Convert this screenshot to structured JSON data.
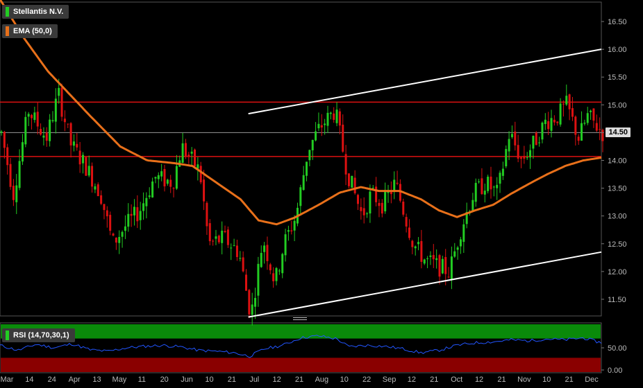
{
  "chart_data": {
    "type": "candlestick",
    "symbol": "Stellantis N.V.",
    "indicator_label": "EMA (50,0)",
    "rsi_label": "RSI (14,70,30,1)",
    "last_price_label": "14.50",
    "last_price": 14.5,
    "price_ylim": [
      11.2,
      16.85
    ],
    "price_ticks": [
      "11.50",
      "12.00",
      "12.50",
      "13.00",
      "13.50",
      "14.00",
      "14.50",
      "15.00",
      "15.50",
      "16.00",
      "16.50"
    ],
    "rsi_ticks": [
      "0.00",
      "50.00"
    ],
    "rsi_ylim": [
      0,
      100
    ],
    "rsi_overbought": 70,
    "rsi_oversold": 30,
    "x_labels": [
      "Mar",
      "14",
      "24",
      "Apr",
      "13",
      "May",
      "11",
      "20",
      "Jun",
      "10",
      "21",
      "Jul",
      "12",
      "21",
      "Aug",
      "10",
      "22",
      "Sep",
      "12",
      "21",
      "Oct",
      "12",
      "21",
      "Nov",
      "10",
      "21",
      "Dec"
    ],
    "horizontal_levels": [
      15.05,
      14.07
    ],
    "trend_channel": {
      "upper": [
        [
          0.413,
          14.84
        ],
        [
          1.0,
          16.0
        ]
      ],
      "lower": [
        [
          0.413,
          11.18
        ],
        [
          1.0,
          12.35
        ]
      ]
    },
    "anchors": [
      [
        0,
        14.5
      ],
      [
        0.02,
        13.4
      ],
      [
        0.045,
        14.9
      ],
      [
        0.075,
        14.4
      ],
      [
        0.095,
        15.2
      ],
      [
        0.115,
        14.3
      ],
      [
        0.14,
        13.9
      ],
      [
        0.165,
        13.4
      ],
      [
        0.185,
        12.5
      ],
      [
        0.205,
        12.8
      ],
      [
        0.23,
        13.1
      ],
      [
        0.255,
        13.7
      ],
      [
        0.285,
        13.6
      ],
      [
        0.3,
        14.25
      ],
      [
        0.33,
        13.8
      ],
      [
        0.345,
        12.5
      ],
      [
        0.37,
        12.6
      ],
      [
        0.395,
        12.35
      ],
      [
        0.415,
        11.2
      ],
      [
        0.435,
        12.6
      ],
      [
        0.455,
        11.8
      ],
      [
        0.47,
        12.5
      ],
      [
        0.49,
        13.0
      ],
      [
        0.51,
        14.2
      ],
      [
        0.53,
        14.6
      ],
      [
        0.555,
        14.9
      ],
      [
        0.575,
        13.8
      ],
      [
        0.6,
        13.0
      ],
      [
        0.615,
        13.4
      ],
      [
        0.635,
        13.2
      ],
      [
        0.655,
        13.6
      ],
      [
        0.685,
        12.5
      ],
      [
        0.705,
        12.2
      ],
      [
        0.725,
        12.1
      ],
      [
        0.745,
        12.0
      ],
      [
        0.765,
        12.8
      ],
      [
        0.785,
        13.4
      ],
      [
        0.805,
        13.6
      ],
      [
        0.825,
        13.4
      ],
      [
        0.845,
        14.5
      ],
      [
        0.865,
        14.0
      ],
      [
        0.885,
        14.3
      ],
      [
        0.905,
        14.7
      ],
      [
        0.925,
        14.8
      ],
      [
        0.94,
        15.0
      ],
      [
        0.96,
        14.4
      ],
      [
        0.975,
        14.8
      ],
      [
        1.0,
        14.5
      ]
    ],
    "ema_anchors": [
      [
        0,
        16.9
      ],
      [
        0.04,
        16.2
      ],
      [
        0.08,
        15.6
      ],
      [
        0.115,
        15.2
      ],
      [
        0.15,
        14.8
      ],
      [
        0.2,
        14.25
      ],
      [
        0.245,
        14.0
      ],
      [
        0.29,
        13.95
      ],
      [
        0.32,
        13.9
      ],
      [
        0.36,
        13.6
      ],
      [
        0.4,
        13.3
      ],
      [
        0.43,
        12.92
      ],
      [
        0.46,
        12.85
      ],
      [
        0.49,
        12.97
      ],
      [
        0.53,
        13.2
      ],
      [
        0.565,
        13.42
      ],
      [
        0.6,
        13.52
      ],
      [
        0.63,
        13.45
      ],
      [
        0.665,
        13.45
      ],
      [
        0.7,
        13.3
      ],
      [
        0.73,
        13.1
      ],
      [
        0.76,
        12.98
      ],
      [
        0.79,
        13.1
      ],
      [
        0.82,
        13.2
      ],
      [
        0.85,
        13.4
      ],
      [
        0.88,
        13.58
      ],
      [
        0.91,
        13.75
      ],
      [
        0.94,
        13.9
      ],
      [
        0.97,
        14.0
      ],
      [
        1.0,
        14.05
      ]
    ],
    "rsi_anchors": [
      [
        0,
        55
      ],
      [
        0.03,
        45
      ],
      [
        0.06,
        57
      ],
      [
        0.09,
        50
      ],
      [
        0.12,
        58
      ],
      [
        0.15,
        46
      ],
      [
        0.18,
        43
      ],
      [
        0.21,
        50
      ],
      [
        0.24,
        53
      ],
      [
        0.27,
        55
      ],
      [
        0.3,
        52
      ],
      [
        0.33,
        45
      ],
      [
        0.36,
        43
      ],
      [
        0.39,
        40
      ],
      [
        0.415,
        33
      ],
      [
        0.44,
        48
      ],
      [
        0.47,
        55
      ],
      [
        0.5,
        70
      ],
      [
        0.53,
        74
      ],
      [
        0.56,
        68
      ],
      [
        0.58,
        52
      ],
      [
        0.61,
        55
      ],
      [
        0.64,
        53
      ],
      [
        0.67,
        48
      ],
      [
        0.7,
        40
      ],
      [
        0.73,
        45
      ],
      [
        0.76,
        55
      ],
      [
        0.79,
        60
      ],
      [
        0.82,
        62
      ],
      [
        0.85,
        66
      ],
      [
        0.88,
        64
      ],
      [
        0.91,
        68
      ],
      [
        0.94,
        66
      ],
      [
        0.97,
        70
      ],
      [
        1.0,
        60
      ]
    ]
  },
  "colors": {
    "up": "#22cc22",
    "down": "#dd1111",
    "ema": "#e8701a",
    "level": "#dd1111",
    "channel": "#ffffff",
    "rsi_line": "#2255ff",
    "rsi_over": "#0a8a0a",
    "rsi_under": "#8a0000",
    "grid": "#2a2a2a",
    "axis_text": "#bbbbbb"
  }
}
